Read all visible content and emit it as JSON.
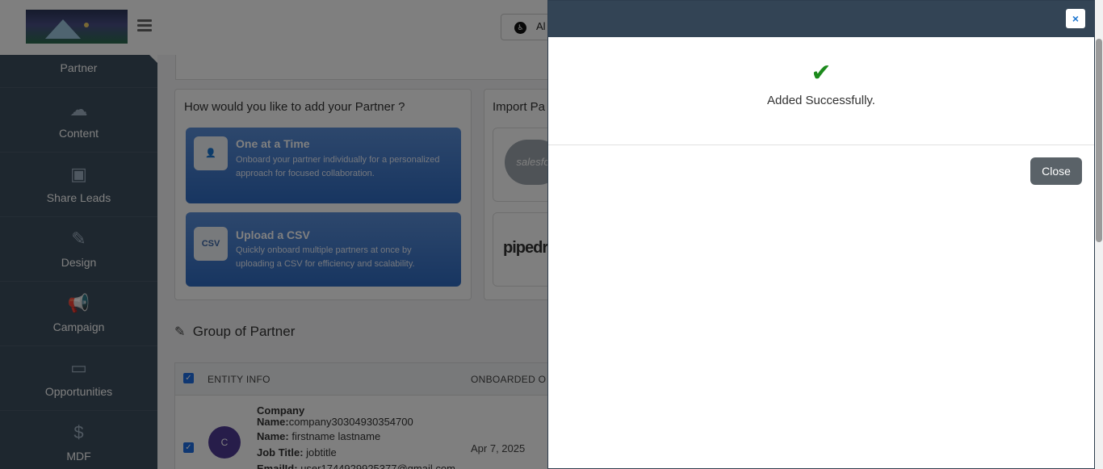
{
  "header": {
    "top_button_label": "Al",
    "top_button_icon": "accessibility-icon"
  },
  "sidebar": {
    "items": [
      {
        "label": "Partner",
        "icon": ""
      },
      {
        "label": "Content",
        "icon": "cloud-upload-icon"
      },
      {
        "label": "Share Leads",
        "icon": "id-badge-icon"
      },
      {
        "label": "Design",
        "icon": "paint-brush-icon"
      },
      {
        "label": "Campaign",
        "icon": "megaphone-icon"
      },
      {
        "label": "Opportunities",
        "icon": "money-icon"
      },
      {
        "label": "MDF",
        "icon": "dollar-icon"
      }
    ]
  },
  "main": {
    "add_partner_title": "How would you like to add your Partner ?",
    "options": [
      {
        "title": "One at a Time",
        "desc": "Onboard your partner individually for a personalized approach for focused collaboration."
      },
      {
        "title": "Upload a CSV",
        "desc": "Quickly onboard multiple partners at once by uploading a CSV for efficiency and scalability."
      }
    ],
    "csv_icon_text": "CSV",
    "import_title": "Import Pa",
    "crm_salesforce": "salesfo",
    "crm_pipedrive": "pipedr",
    "group_title": "Group of Partner",
    "table": {
      "headers": [
        "ENTITY INFO",
        "ONBOARDED O"
      ],
      "row": {
        "avatar": "C",
        "company_label": "Company",
        "company_name_label": "Name:",
        "company_name": "company30304930354700",
        "name_label": "Name:",
        "name": "firstname  lastname",
        "job_label": "Job Title:",
        "job": "jobtitle",
        "email_label": "EmailId:",
        "email": "user1744929925377@gmail.com",
        "date": "Apr 7, 2025"
      }
    }
  },
  "modal": {
    "message": "Added Successfully.",
    "close_label": "Close",
    "close_x": "×",
    "check_color": "#1c8a1c"
  }
}
